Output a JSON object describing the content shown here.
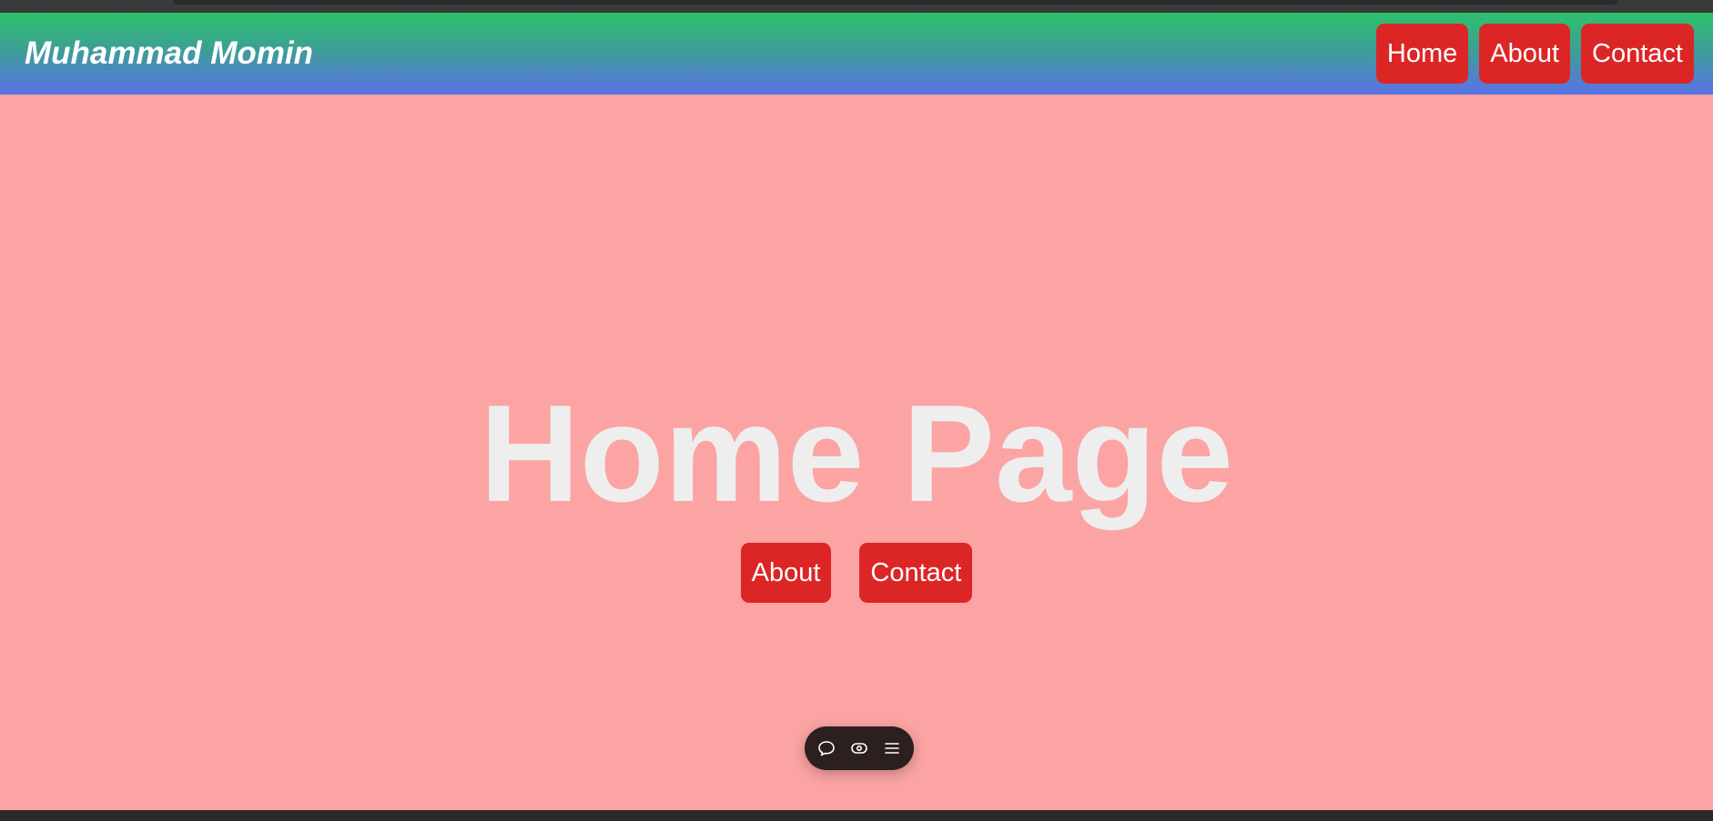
{
  "navbar": {
    "brand": "Muhammad Momin",
    "links": [
      {
        "label": "Home"
      },
      {
        "label": "About"
      },
      {
        "label": "Contact"
      }
    ]
  },
  "hero": {
    "title": "Home Page",
    "buttons": [
      {
        "label": "About"
      },
      {
        "label": "Contact"
      }
    ]
  },
  "toolbar": {
    "icons": [
      "comment-icon",
      "eye-icon",
      "menu-icon"
    ]
  },
  "colors": {
    "navbar_gradient_top": "#2ec16a",
    "navbar_gradient_bottom": "#5b72e6",
    "page_background": "#fba4a3",
    "button_background": "#dc2626",
    "hero_title": "#eeeeee",
    "toolbar_background": "#2b1f1f"
  }
}
